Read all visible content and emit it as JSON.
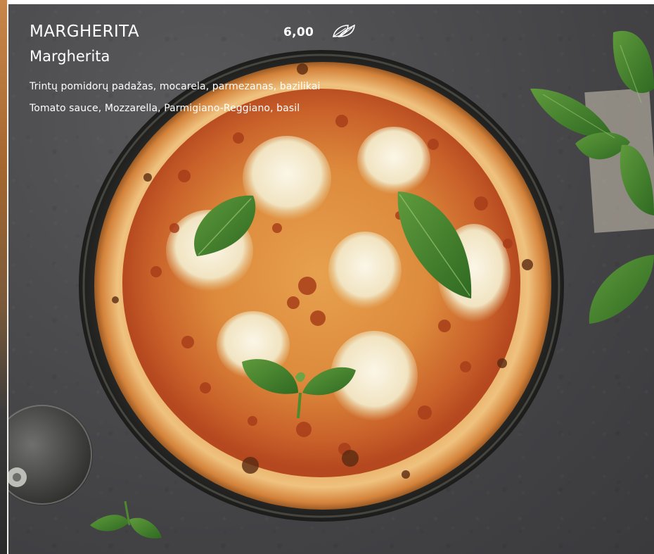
{
  "menu_item": {
    "title": "MARGHERITA",
    "subtitle": "Margherita",
    "price": "6,00",
    "diet_icon": "leaf-icon",
    "description_lt": "Trintų pomidorų padažas, mocarela, parmezanas, bazilikai",
    "description_en": "Tomato sauce, Mozzarella, Parmigiano-Reggiano, basil"
  },
  "colors": {
    "background": "#48484b",
    "text": "#ffffff",
    "crust": "#d98b3a",
    "sauce": "#c5521f",
    "cheese": "#f3ead2",
    "basil": "#3f7b2a"
  }
}
